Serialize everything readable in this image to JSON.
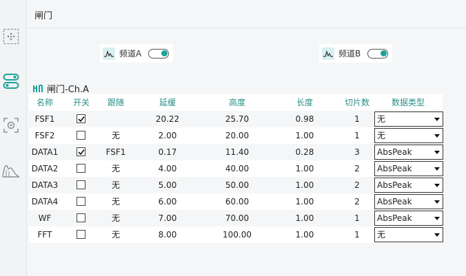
{
  "header": {
    "title": "闸门"
  },
  "sidebar": {
    "icons": [
      "move-crosshair-icon",
      "toggle-switch-icon",
      "focus-target-icon",
      "waveform-peaks-icon"
    ]
  },
  "channels": [
    {
      "label": "频道A",
      "on": true
    },
    {
      "label": "频道B",
      "on": true
    }
  ],
  "section": {
    "title": "闸门-Ch.A"
  },
  "table": {
    "headers": {
      "name": "名称",
      "switch": "开关",
      "follow": "跟随",
      "delay": "延缓",
      "height": "高度",
      "length": "长度",
      "slices": "切片数",
      "type": "数据类型"
    },
    "rows": [
      {
        "name": "FSF1",
        "checked": true,
        "follow": "",
        "delay": "20.22",
        "height": "25.70",
        "length": "0.98",
        "slices": "1",
        "type": "无"
      },
      {
        "name": "FSF2",
        "checked": false,
        "follow": "无",
        "delay": "2.00",
        "height": "20.00",
        "length": "1.00",
        "slices": "1",
        "type": "无"
      },
      {
        "name": "DATA1",
        "checked": true,
        "follow": "FSF1",
        "delay": "0.17",
        "height": "11.40",
        "length": "0.28",
        "slices": "3",
        "type": "AbsPeak"
      },
      {
        "name": "DATA2",
        "checked": false,
        "follow": "无",
        "delay": "4.00",
        "height": "40.00",
        "length": "1.00",
        "slices": "2",
        "type": "AbsPeak"
      },
      {
        "name": "DATA3",
        "checked": false,
        "follow": "无",
        "delay": "5.00",
        "height": "50.00",
        "length": "1.00",
        "slices": "2",
        "type": "AbsPeak"
      },
      {
        "name": "DATA4",
        "checked": false,
        "follow": "无",
        "delay": "6.00",
        "height": "60.00",
        "length": "1.00",
        "slices": "2",
        "type": "AbsPeak"
      },
      {
        "name": "WF",
        "checked": false,
        "follow": "无",
        "delay": "7.00",
        "height": "70.00",
        "length": "1.00",
        "slices": "1",
        "type": "AbsPeak"
      },
      {
        "name": "FFT",
        "checked": false,
        "follow": "无",
        "delay": "8.00",
        "height": "100.00",
        "length": "1.00",
        "slices": "1",
        "type": "无"
      }
    ]
  },
  "colors": {
    "accent": "#1aa39a",
    "header_text": "#2a8f8a"
  }
}
